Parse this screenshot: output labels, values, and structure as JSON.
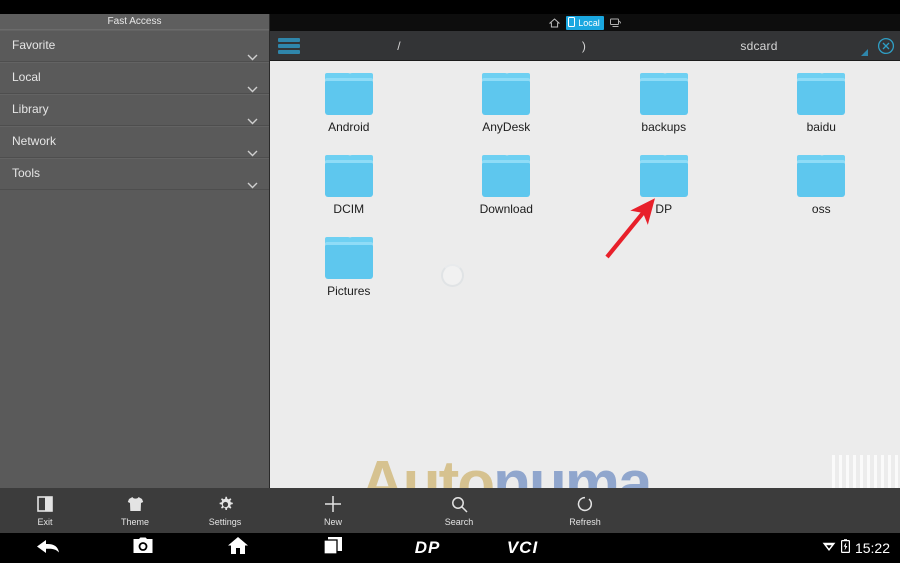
{
  "sidebar": {
    "title": "Fast Access",
    "items": [
      {
        "label": "Favorite",
        "icon": "chevron-down-icon"
      },
      {
        "label": "Local",
        "icon": "chevron-down-icon"
      },
      {
        "label": "Library",
        "icon": "chevron-down-icon"
      },
      {
        "label": "Network",
        "icon": "chevron-down-icon"
      },
      {
        "label": "Tools",
        "icon": "chevron-down-icon"
      }
    ]
  },
  "tabbar": {
    "home_icon": "home-icon",
    "active_tab": "Local",
    "local_icon": "phone-device-icon",
    "other_icon": "computer-network-icon"
  },
  "pathbar": {
    "menu_icon": "hamburger-menu-icon",
    "crumbs": [
      "/",
      ")",
      "sdcard"
    ],
    "close_icon": "close-circle-icon",
    "resize_icon": "resize-handle-icon"
  },
  "files": [
    {
      "name": "Android",
      "type": "folder"
    },
    {
      "name": "AnyDesk",
      "type": "folder"
    },
    {
      "name": "backups",
      "type": "folder"
    },
    {
      "name": "baidu",
      "type": "folder"
    },
    {
      "name": "DCIM",
      "type": "folder"
    },
    {
      "name": "Download",
      "type": "folder"
    },
    {
      "name": "DP",
      "type": "folder"
    },
    {
      "name": "oss",
      "type": "folder"
    },
    {
      "name": "Pictures",
      "type": "folder"
    }
  ],
  "annotation": {
    "arrow_color": "#e8202a",
    "points_at": "DP"
  },
  "toolbar": {
    "left": [
      {
        "label": "Exit",
        "icon": "exit-door-icon"
      },
      {
        "label": "Theme",
        "icon": "tshirt-icon"
      },
      {
        "label": "Settings",
        "icon": "gear-icon"
      }
    ],
    "right": [
      {
        "label": "New",
        "icon": "plus-icon"
      },
      {
        "label": "Search",
        "icon": "search-icon"
      },
      {
        "label": "Refresh",
        "icon": "refresh-icon"
      }
    ]
  },
  "navbar": {
    "buttons": [
      {
        "name": "back",
        "icon": "back-arrow-icon"
      },
      {
        "name": "camera",
        "icon": "camera-icon"
      },
      {
        "name": "home",
        "icon": "home-icon"
      },
      {
        "name": "recents",
        "icon": "recent-apps-icon"
      }
    ],
    "brand_dp": "DP",
    "brand_vci": "VCI",
    "wifi_icon": "wifi-icon",
    "battery_icon": "battery-charging-icon",
    "clock": "15:22"
  },
  "watermark": {
    "part1": "Auto",
    "part2": "numa"
  },
  "colors": {
    "accent_blue": "#1aa7e0",
    "folder_blue": "#5ec7ee",
    "sidebar_gray": "#5a5a5a",
    "toolbar_gray": "#3c3c3c",
    "content_bg": "#ececec",
    "arrow_red": "#e8202a"
  }
}
